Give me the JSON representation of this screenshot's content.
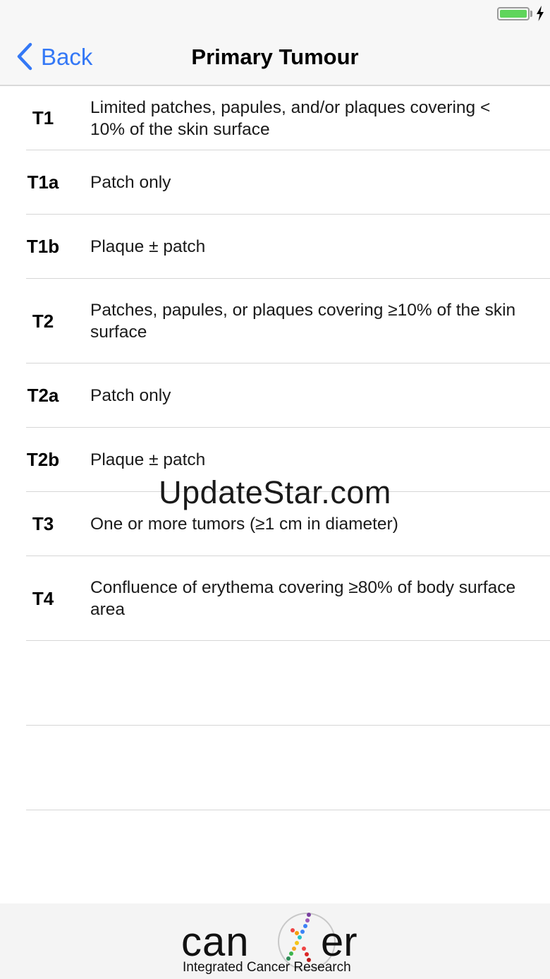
{
  "status_bar": {
    "battery_icon": "battery-full-icon",
    "charging_icon": "charging-bolt-icon",
    "battery_color": "#5fd55b"
  },
  "nav": {
    "back_label": "Back",
    "back_icon": "chevron-left-icon",
    "title": "Primary Tumour",
    "accent": "#3478f6"
  },
  "rows": [
    {
      "stage": "T1",
      "desc": "Limited patches, papules, and/or plaques covering < 10% of the skin surface"
    },
    {
      "stage": "T1a",
      "desc": "Patch only"
    },
    {
      "stage": "T1b",
      "desc": "Plaque ± patch"
    },
    {
      "stage": "T2",
      "desc": "Patches, papules, or plaques covering ≥10% of the skin surface"
    },
    {
      "stage": "T2a",
      "desc": "Patch only"
    },
    {
      "stage": "T2b",
      "desc": "Plaque ± patch"
    },
    {
      "stage": "T3",
      "desc": "One or more tumors (≥1 cm in diameter)"
    },
    {
      "stage": "T4",
      "desc": "Confluence of erythema covering ≥80% of body surface area"
    },
    {
      "stage": "",
      "desc": ""
    },
    {
      "stage": "",
      "desc": ""
    }
  ],
  "watermark": "UpdateStar.com",
  "footer": {
    "brand": "can er",
    "tagline": "Integrated Cancer Research"
  }
}
